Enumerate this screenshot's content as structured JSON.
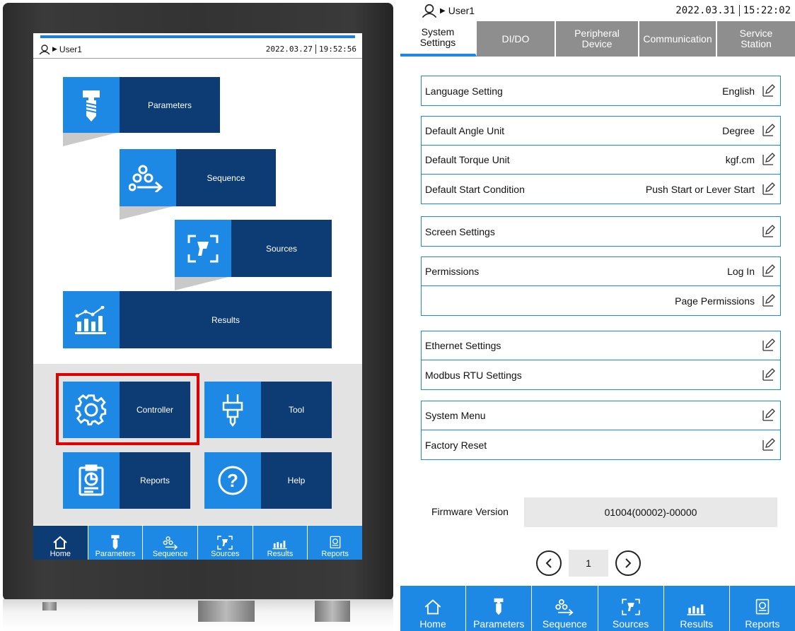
{
  "left_screen": {
    "status": {
      "user": "User1",
      "date": "2022.03.27",
      "time": "19:52:56"
    },
    "tiles": {
      "parameters": "Parameters",
      "sequence": "Sequence",
      "sources": "Sources",
      "results": "Results",
      "controller": "Controller",
      "tool": "Tool",
      "reports": "Reports",
      "help": "Help"
    },
    "nav": [
      "Home",
      "Parameters",
      "Sequence",
      "Sources",
      "Results",
      "Reports"
    ],
    "highlight_color": "#e00000"
  },
  "right_screen": {
    "status": {
      "user": "User1",
      "date": "2022.03.31",
      "time": "15:22:02"
    },
    "tabs": [
      {
        "label": "System\nSettings",
        "active": true
      },
      {
        "label": "DI/DO"
      },
      {
        "label": "Peripheral\nDevice"
      },
      {
        "label": "Communication"
      },
      {
        "label": "Service\nStation"
      }
    ],
    "settings": {
      "language": {
        "label": "Language Setting",
        "value": "English"
      },
      "angle": {
        "label": "Default Angle Unit",
        "value": "Degree"
      },
      "torque": {
        "label": "Default Torque Unit",
        "value": "kgf.cm"
      },
      "start": {
        "label": "Default Start Condition",
        "value": "Push Start or Lever Start"
      },
      "screen": {
        "label": "Screen Settings"
      },
      "permissions": {
        "label": "Permissions",
        "value": "Log In"
      },
      "page_permissions": {
        "value": "Page Permissions"
      },
      "ethernet": {
        "label": "Ethernet Settings"
      },
      "modbus": {
        "label": "Modbus RTU Settings"
      },
      "system_menu": {
        "label": "System Menu"
      },
      "factory_reset": {
        "label": "Factory Reset"
      }
    },
    "firmware": {
      "label": "Firmware Version",
      "value": "01004(00002)-00000"
    },
    "page": "1",
    "nav": [
      "Home",
      "Parameters",
      "Sequence",
      "Sources",
      "Results",
      "Reports"
    ]
  },
  "colors": {
    "accent": "#1e88e5",
    "dark": "#0d3b73",
    "tab_gray": "#8e8e8e"
  }
}
